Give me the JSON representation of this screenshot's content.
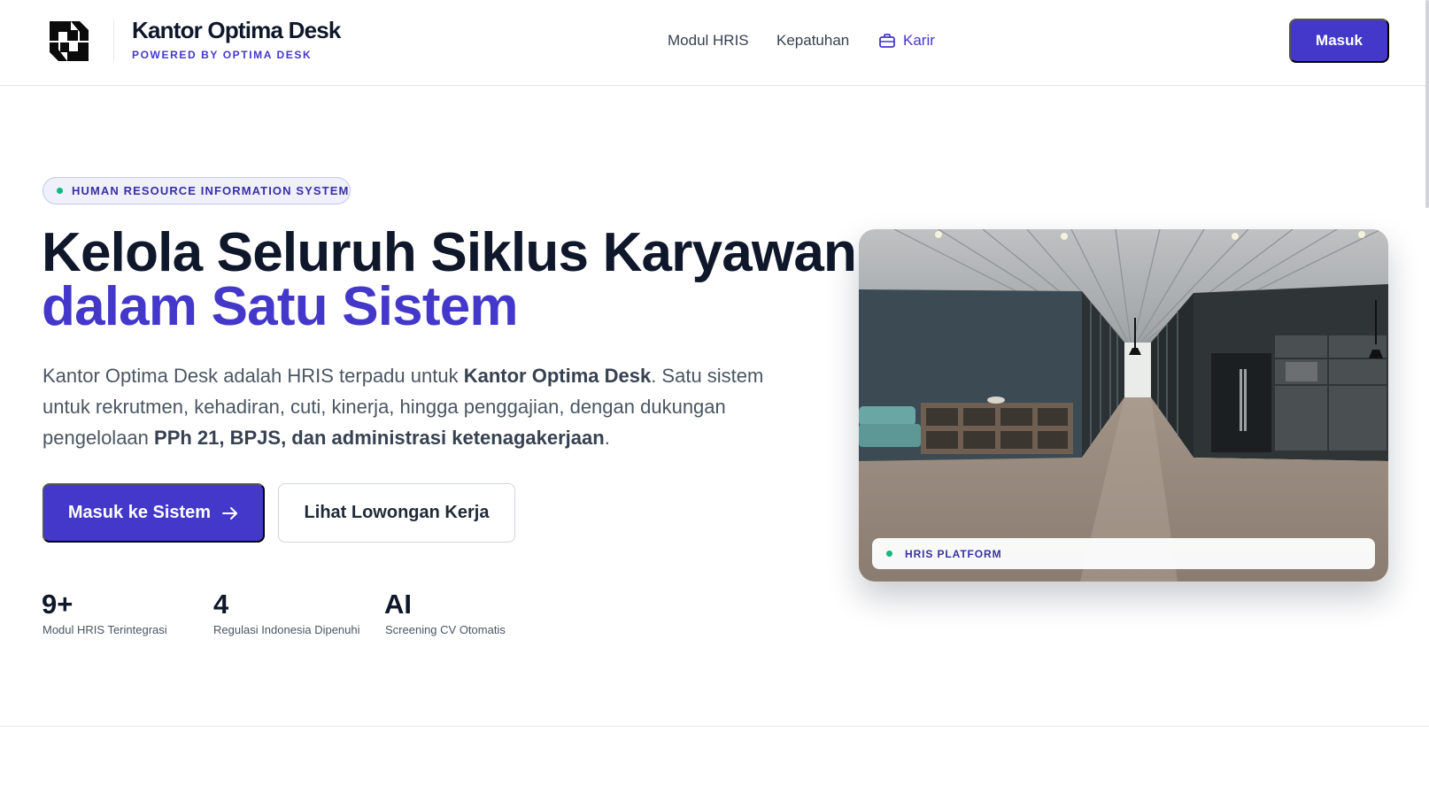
{
  "header": {
    "brand_name": "Kantor Optima Desk",
    "brand_sub": "POWERED BY OPTIMA DESK",
    "nav": {
      "hris": "Modul HRIS",
      "kepatuhan": "Kepatuhan",
      "karir": "Karir"
    },
    "login_label": "Masuk"
  },
  "hero": {
    "pill": "HUMAN RESOURCE INFORMATION SYSTEM",
    "title_line1": "Kelola Seluruh Siklus Karyawan",
    "title_line2": "dalam Satu Sistem",
    "desc": {
      "p1": "Kantor Optima Desk adalah HRIS terpadu untuk ",
      "b1": "Kantor Optima Desk",
      "p2": ". Satu sistem untuk rekrutmen, kehadiran, cuti, kinerja, hingga penggajian, dengan dukungan pengelolaan ",
      "b2": "PPh 21, BPJS, dan administrasi ketenagakerjaan",
      "p3": "."
    },
    "primary_button": "Masuk ke Sistem",
    "secondary_button": "Lihat Lowongan Kerja",
    "stats": [
      {
        "value": "9+",
        "label": "Modul HRIS Terintegrasi"
      },
      {
        "value": "4",
        "label": "Regulasi Indonesia Dipenuhi"
      },
      {
        "value": "AI",
        "label": "Screening CV Otomatis"
      }
    ],
    "image_card_label": "HRIS PLATFORM"
  },
  "colors": {
    "accent": "#4338ca",
    "status_dot": "#10b981",
    "heading": "#0f172a"
  },
  "icons": {
    "logo": "optima-desk-logo",
    "karir": "briefcase-icon",
    "primary_button": "arrow-right-icon"
  }
}
